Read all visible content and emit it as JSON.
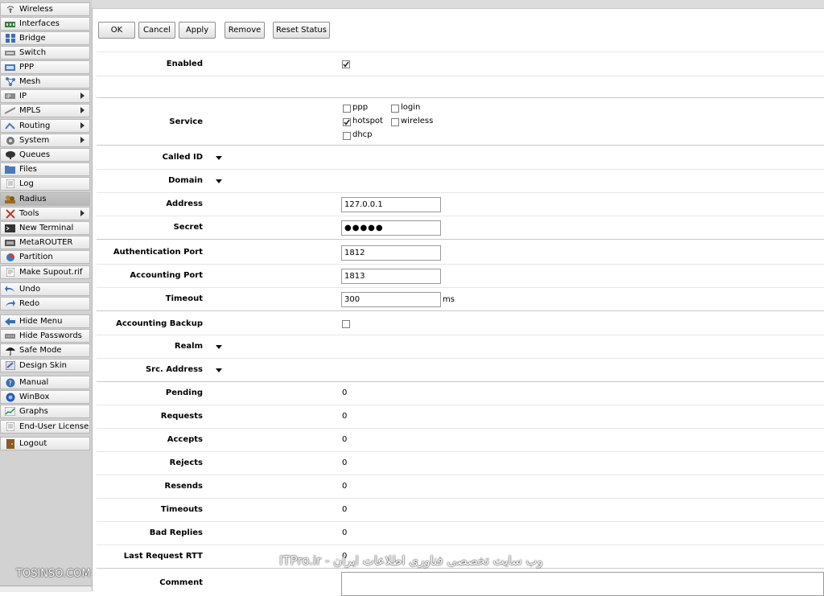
{
  "sidebar": {
    "items": [
      {
        "label": "Wireless",
        "icon": "wireless-icon",
        "arrow": false
      },
      {
        "label": "Interfaces",
        "icon": "interfaces-icon",
        "arrow": false
      },
      {
        "label": "Bridge",
        "icon": "bridge-icon",
        "arrow": false
      },
      {
        "label": "Switch",
        "icon": "switch-icon",
        "arrow": false
      },
      {
        "label": "PPP",
        "icon": "ppp-icon",
        "arrow": false
      },
      {
        "label": "Mesh",
        "icon": "mesh-icon",
        "arrow": false
      },
      {
        "label": "IP",
        "icon": "ip-icon",
        "arrow": true
      },
      {
        "label": "MPLS",
        "icon": "mpls-icon",
        "arrow": true
      },
      {
        "label": "Routing",
        "icon": "routing-icon",
        "arrow": true
      },
      {
        "label": "System",
        "icon": "system-gear-icon",
        "arrow": true
      },
      {
        "label": "Queues",
        "icon": "queues-icon",
        "arrow": false
      },
      {
        "label": "Files",
        "icon": "files-icon",
        "arrow": false
      },
      {
        "label": "Log",
        "icon": "log-icon",
        "arrow": false
      },
      {
        "label": "Radius",
        "icon": "radius-icon",
        "arrow": false,
        "active": true
      },
      {
        "label": "Tools",
        "icon": "tools-icon",
        "arrow": true
      },
      {
        "label": "New Terminal",
        "icon": "terminal-icon",
        "arrow": false
      },
      {
        "label": "MetaROUTER",
        "icon": "metarouter-icon",
        "arrow": false
      },
      {
        "label": "Partition",
        "icon": "partition-icon",
        "arrow": false
      },
      {
        "label": "Make Supout.rif",
        "icon": "supout-icon",
        "arrow": false
      },
      {
        "label": "Undo",
        "icon": "undo-icon",
        "arrow": false
      },
      {
        "label": "Redo",
        "icon": "redo-icon",
        "arrow": false
      },
      {
        "label": "Hide Menu",
        "icon": "hide-menu-icon",
        "arrow": false
      },
      {
        "label": "Hide Passwords",
        "icon": "hide-passwords-icon",
        "arrow": false
      },
      {
        "label": "Safe Mode",
        "icon": "safe-mode-icon",
        "arrow": false
      },
      {
        "label": "Design Skin",
        "icon": "design-skin-icon",
        "arrow": false
      },
      {
        "label": "Manual",
        "icon": "manual-icon",
        "arrow": false
      },
      {
        "label": "WinBox",
        "icon": "winbox-icon",
        "arrow": false
      },
      {
        "label": "Graphs",
        "icon": "graphs-icon",
        "arrow": false
      },
      {
        "label": "End-User License",
        "icon": "license-icon",
        "arrow": false
      },
      {
        "label": "Logout",
        "icon": "logout-icon",
        "arrow": false
      }
    ]
  },
  "toolbar": {
    "ok": "OK",
    "cancel": "Cancel",
    "apply": "Apply",
    "remove": "Remove",
    "reset_status": "Reset Status"
  },
  "form": {
    "enabled": {
      "label": "Enabled",
      "checked": true
    },
    "service": {
      "label": "Service",
      "options": [
        {
          "label": "ppp",
          "checked": false
        },
        {
          "label": "login",
          "checked": false
        },
        {
          "label": "hotspot",
          "checked": true
        },
        {
          "label": "wireless",
          "checked": false
        },
        {
          "label": "dhcp",
          "checked": false
        }
      ]
    },
    "called_id": {
      "label": "Called ID"
    },
    "domain": {
      "label": "Domain"
    },
    "address": {
      "label": "Address",
      "value": "127.0.0.1"
    },
    "secret": {
      "label": "Secret",
      "value": "●●●●●"
    },
    "auth_port": {
      "label": "Authentication Port",
      "value": "1812"
    },
    "acct_port": {
      "label": "Accounting Port",
      "value": "1813"
    },
    "timeout": {
      "label": "Timeout",
      "value": "300",
      "unit": "ms"
    },
    "acct_backup": {
      "label": "Accounting Backup",
      "checked": false
    },
    "realm": {
      "label": "Realm"
    },
    "src_address": {
      "label": "Src. Address"
    },
    "stats": [
      {
        "label": "Pending",
        "value": "0"
      },
      {
        "label": "Requests",
        "value": "0"
      },
      {
        "label": "Accepts",
        "value": "0"
      },
      {
        "label": "Rejects",
        "value": "0"
      },
      {
        "label": "Resends",
        "value": "0"
      },
      {
        "label": "Timeouts",
        "value": "0"
      },
      {
        "label": "Bad Replies",
        "value": "0"
      },
      {
        "label": "Last Request RTT",
        "value": "0"
      }
    ],
    "comment": {
      "label": "Comment",
      "value": ""
    }
  },
  "watermarks": {
    "left": "TOSINSO.COM",
    "right": "ITPro.ir - وب سایت تخصصی فناوری اطلاعات ایران"
  }
}
